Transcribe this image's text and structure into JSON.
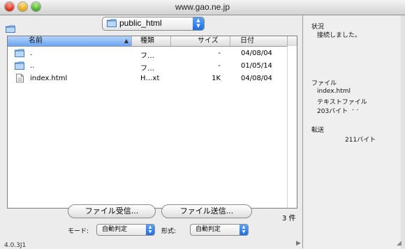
{
  "window": {
    "title": "www.gao.ne.jp"
  },
  "path": {
    "current": "public_html"
  },
  "list": {
    "columns": {
      "name": "名前",
      "type": "種類",
      "size": "サイズ",
      "date": "日付"
    },
    "rows": [
      {
        "icon": "folder-icon",
        "name": ".",
        "type": "フ…",
        "size": "-",
        "date": "04/08/04"
      },
      {
        "icon": "folder-icon",
        "name": "..",
        "type": "フ…",
        "size": "-",
        "date": "01/05/14"
      },
      {
        "icon": "html-file-icon",
        "name": "index.html",
        "type": "H…xt",
        "size": "1K",
        "date": "04/08/04"
      }
    ],
    "count": "3 件"
  },
  "buttons": {
    "receive": "ファイル受信...",
    "send": "ファイル送信..."
  },
  "mode": {
    "label": "モード:",
    "value": "自動判定"
  },
  "format": {
    "label": "形式:",
    "value": "自動判定"
  },
  "version": "4.0.3J1",
  "status": {
    "header": "状況",
    "message": "接続しました。",
    "file_header": "ファイル",
    "file_name": "index.html",
    "file_type": "テキストファイル",
    "file_bytes": "203バイト",
    "transfer_header": "転送",
    "transfer_bytes": "211バイト"
  }
}
